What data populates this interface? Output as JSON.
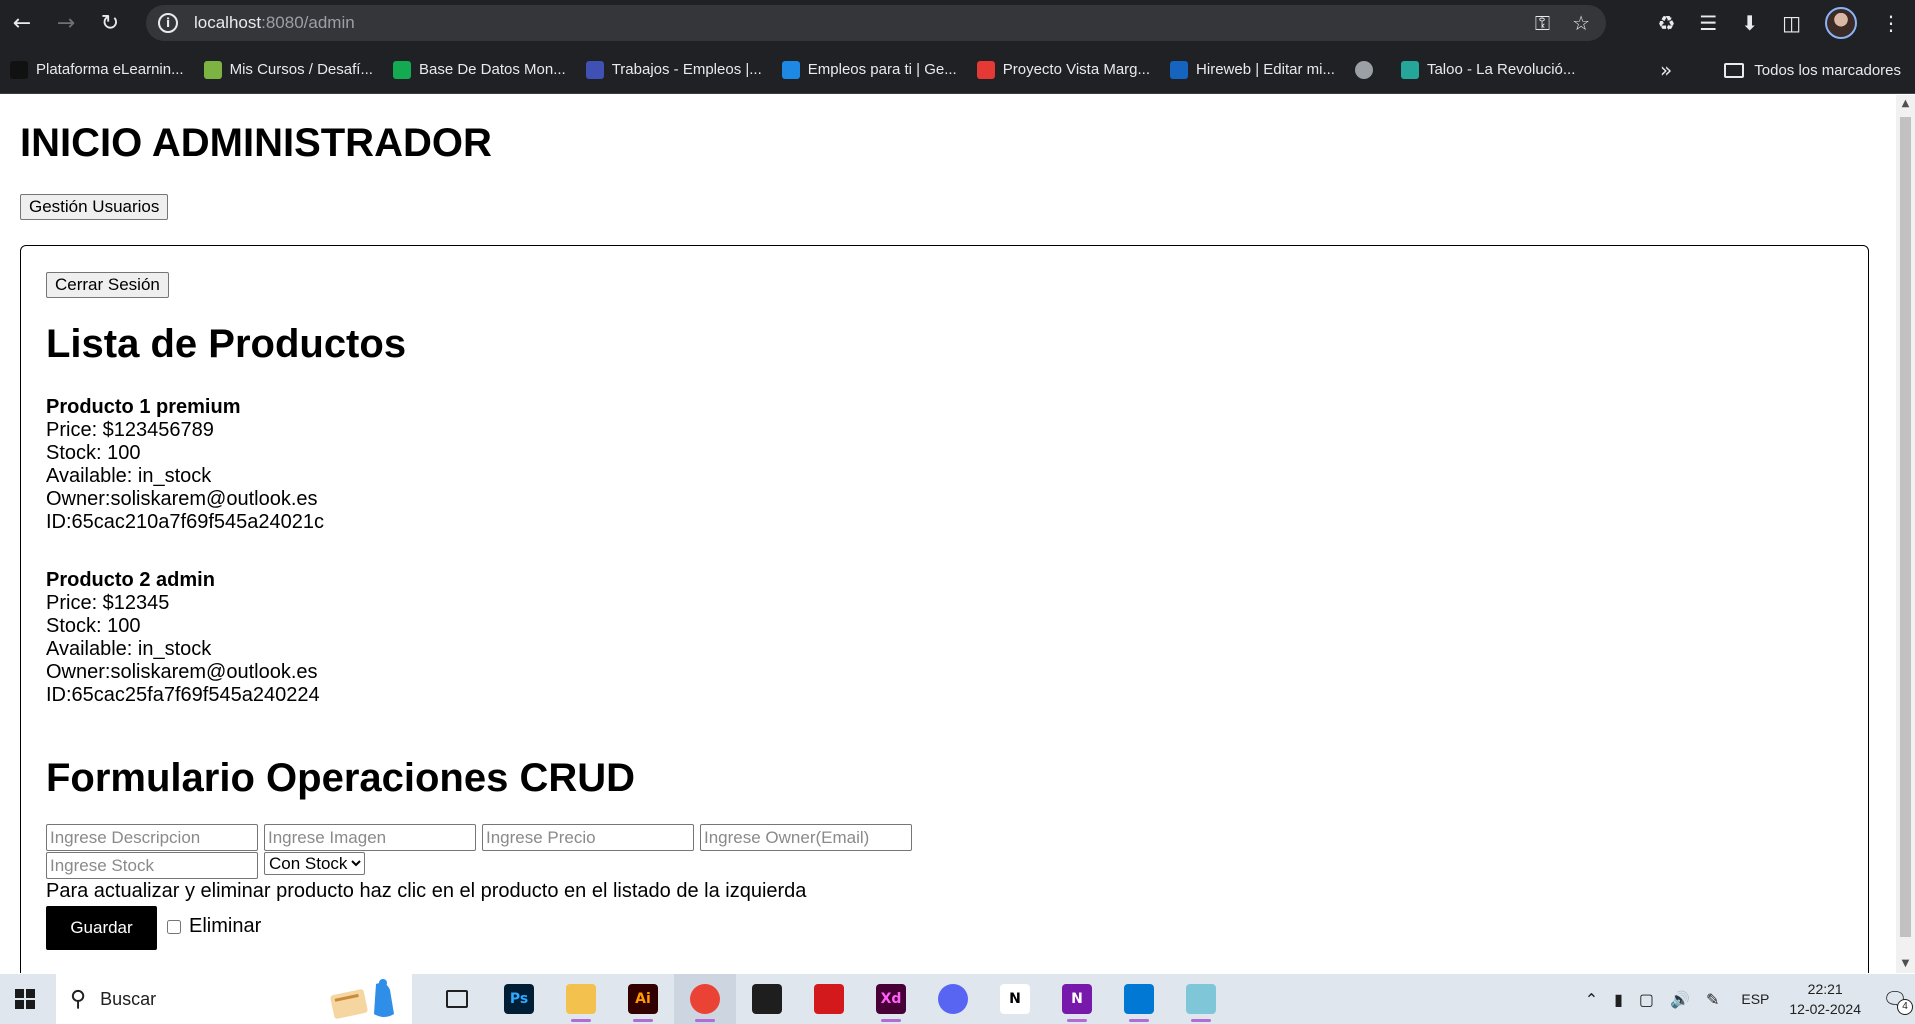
{
  "browser": {
    "url_host": "localhost",
    "url_rest": ":8080/admin",
    "bookmarks": [
      {
        "label": "Plataforma eLearnin...",
        "icon": "elearning-icon",
        "color": "#111111"
      },
      {
        "label": "Mis Cursos / Desafí...",
        "icon": "courses-icon",
        "color": "#7cb342"
      },
      {
        "label": "Base De Datos Mon...",
        "icon": "mongodb-leaf-icon",
        "color": "#13aa52"
      },
      {
        "label": "Trabajos - Empleos |...",
        "icon": "jobs-chevron-icon",
        "color": "#3f51b5"
      },
      {
        "label": "Empleos para ti | Ge...",
        "icon": "getonboard-icon",
        "color": "#1e88e5"
      },
      {
        "label": "Proyecto Vista Marg...",
        "icon": "project-icon",
        "color": "#e53935"
      },
      {
        "label": "Hireweb | Editar mi...",
        "icon": "hireweb-icon",
        "color": "#1565c0"
      },
      {
        "label": "",
        "icon": "globe-icon",
        "color": "#9aa0a6"
      },
      {
        "label": "Taloo - La Revolució...",
        "icon": "taloo-icon",
        "color": "#26a69a"
      }
    ],
    "all_bookmarks_label": "Todos los marcadores"
  },
  "page": {
    "title": "INICIO ADMINISTRADOR",
    "users_button": "Gestión Usuarios",
    "logout_button": "Cerrar Sesión",
    "list_heading": "Lista de Productos",
    "products": [
      {
        "name": "Producto 1 premium",
        "price": "Price: $123456789",
        "stock": "Stock: 100",
        "available": "Available: in_stock",
        "owner": "Owner:soliskarem@outlook.es",
        "id": "ID:65cac210a7f69f545a24021c"
      },
      {
        "name": "Producto 2 admin",
        "price": "Price: $12345",
        "stock": "Stock: 100",
        "available": "Available: in_stock",
        "owner": "Owner:soliskarem@outlook.es",
        "id": "ID:65cac25fa7f69f545a240224"
      }
    ],
    "crud_heading": "Formulario Operaciones CRUD",
    "form": {
      "description_placeholder": "Ingrese Descripcion",
      "image_placeholder": "Ingrese Imagen",
      "price_placeholder": "Ingrese Precio",
      "owner_placeholder": "Ingrese Owner(Email)",
      "stock_placeholder": "Ingrese Stock",
      "availability_selected": "Con Stock",
      "hint": "Para actualizar y eliminar producto haz clic en el producto en el listado de la izquierda",
      "save_button": "Guardar",
      "delete_label": "Eliminar"
    }
  },
  "taskbar": {
    "search_label": "Buscar",
    "apps": [
      {
        "icon": "task-view-icon",
        "label": "",
        "bg": "transparent",
        "fg": "#202020"
      },
      {
        "icon": "photoshop-icon",
        "label": "Ps",
        "bg": "#001e36",
        "fg": "#31a8ff"
      },
      {
        "icon": "file-explorer-icon",
        "label": "",
        "bg": "#f2c14e",
        "fg": "#202020"
      },
      {
        "icon": "illustrator-icon",
        "label": "Ai",
        "bg": "#330000",
        "fg": "#ff9a00"
      },
      {
        "icon": "chrome-icon",
        "label": "",
        "bg": "#ea4335",
        "fg": "#ffffff"
      },
      {
        "icon": "figma-icon",
        "label": "",
        "bg": "#1e1e1e",
        "fg": "#f24e1e"
      },
      {
        "icon": "acrobat-icon",
        "label": "",
        "bg": "#d4191c",
        "fg": "#ffffff"
      },
      {
        "icon": "xd-icon",
        "label": "Xd",
        "bg": "#470137",
        "fg": "#ff61f6"
      },
      {
        "icon": "discord-icon",
        "label": "",
        "bg": "#5865f2",
        "fg": "#ffffff"
      },
      {
        "icon": "notion-icon",
        "label": "N",
        "bg": "#ffffff",
        "fg": "#000000"
      },
      {
        "icon": "onenote-icon",
        "label": "N",
        "bg": "#7719aa",
        "fg": "#ffffff"
      },
      {
        "icon": "vscode-icon",
        "label": "",
        "bg": "#0078d4",
        "fg": "#ffffff"
      },
      {
        "icon": "notepad-icon",
        "label": "",
        "bg": "#7fc6d8",
        "fg": "#ffffff"
      }
    ],
    "language": "ESP",
    "time": "22:21",
    "date": "12-02-2024",
    "notification_count": "4"
  }
}
